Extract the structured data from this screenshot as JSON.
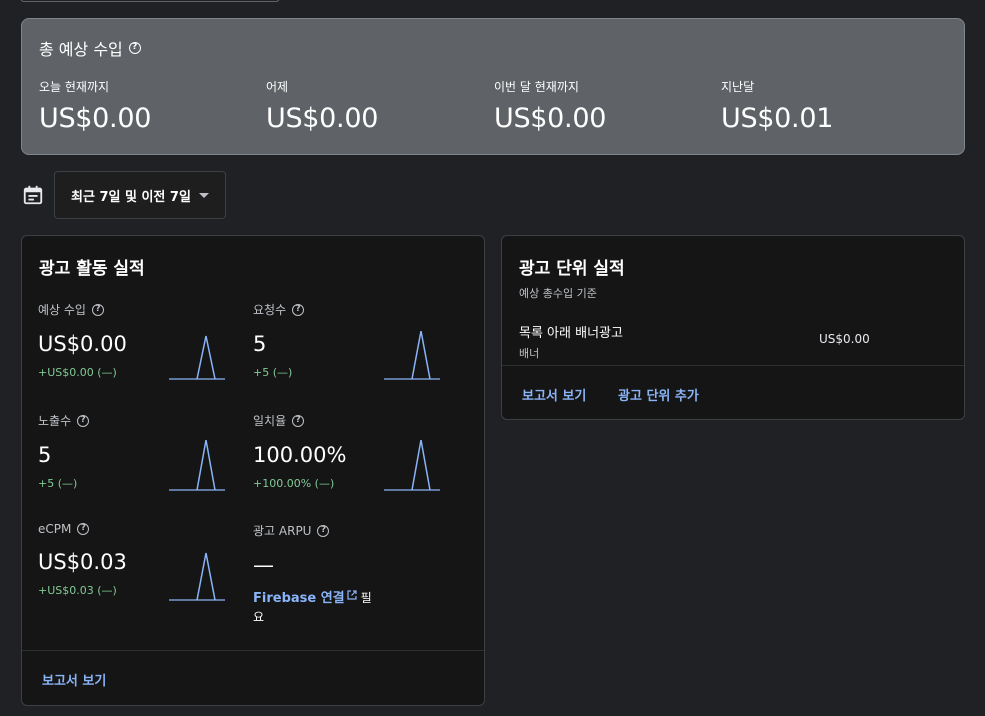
{
  "summary": {
    "title": "총 예상 수입",
    "items": [
      {
        "label": "오늘 현재까지",
        "value": "US$0.00"
      },
      {
        "label": "어제",
        "value": "US$0.00"
      },
      {
        "label": "이번 달 현재까지",
        "value": "US$0.00"
      },
      {
        "label": "지난달",
        "value": "US$0.01"
      }
    ]
  },
  "date_filter": {
    "label": "최근 7일 및 이전 7일"
  },
  "activity": {
    "title": "광고 활동 실적",
    "metrics": [
      {
        "label": "예상 수입",
        "value": "US$0.00",
        "delta": "+US$0.00 (—)"
      },
      {
        "label": "요청수",
        "value": "5",
        "delta": "+5 (—)"
      },
      {
        "label": "노출수",
        "value": "5",
        "delta": "+5 (—)"
      },
      {
        "label": "일치율",
        "value": "100.00%",
        "delta": "+100.00% (—)"
      },
      {
        "label": "eCPM",
        "value": "US$0.03",
        "delta": "+US$0.03 (—)"
      },
      {
        "label": "광고 ARPU",
        "value": "—"
      }
    ],
    "firebase_link": "Firebase 연결",
    "firebase_suffix": "필요",
    "report_link": "보고서 보기"
  },
  "adunit": {
    "title": "광고 단위 실적",
    "subtitle": "예상 총수입 기준",
    "rows": [
      {
        "name": "목록 아래 배너광고",
        "type": "배너",
        "value": "US$0.00"
      }
    ],
    "report_link": "보고서 보기",
    "add_link": "광고 단위 추가"
  },
  "colors": {
    "accent": "#8ab4f8",
    "positive": "#81c995",
    "summary_bg": "#5f6368"
  }
}
